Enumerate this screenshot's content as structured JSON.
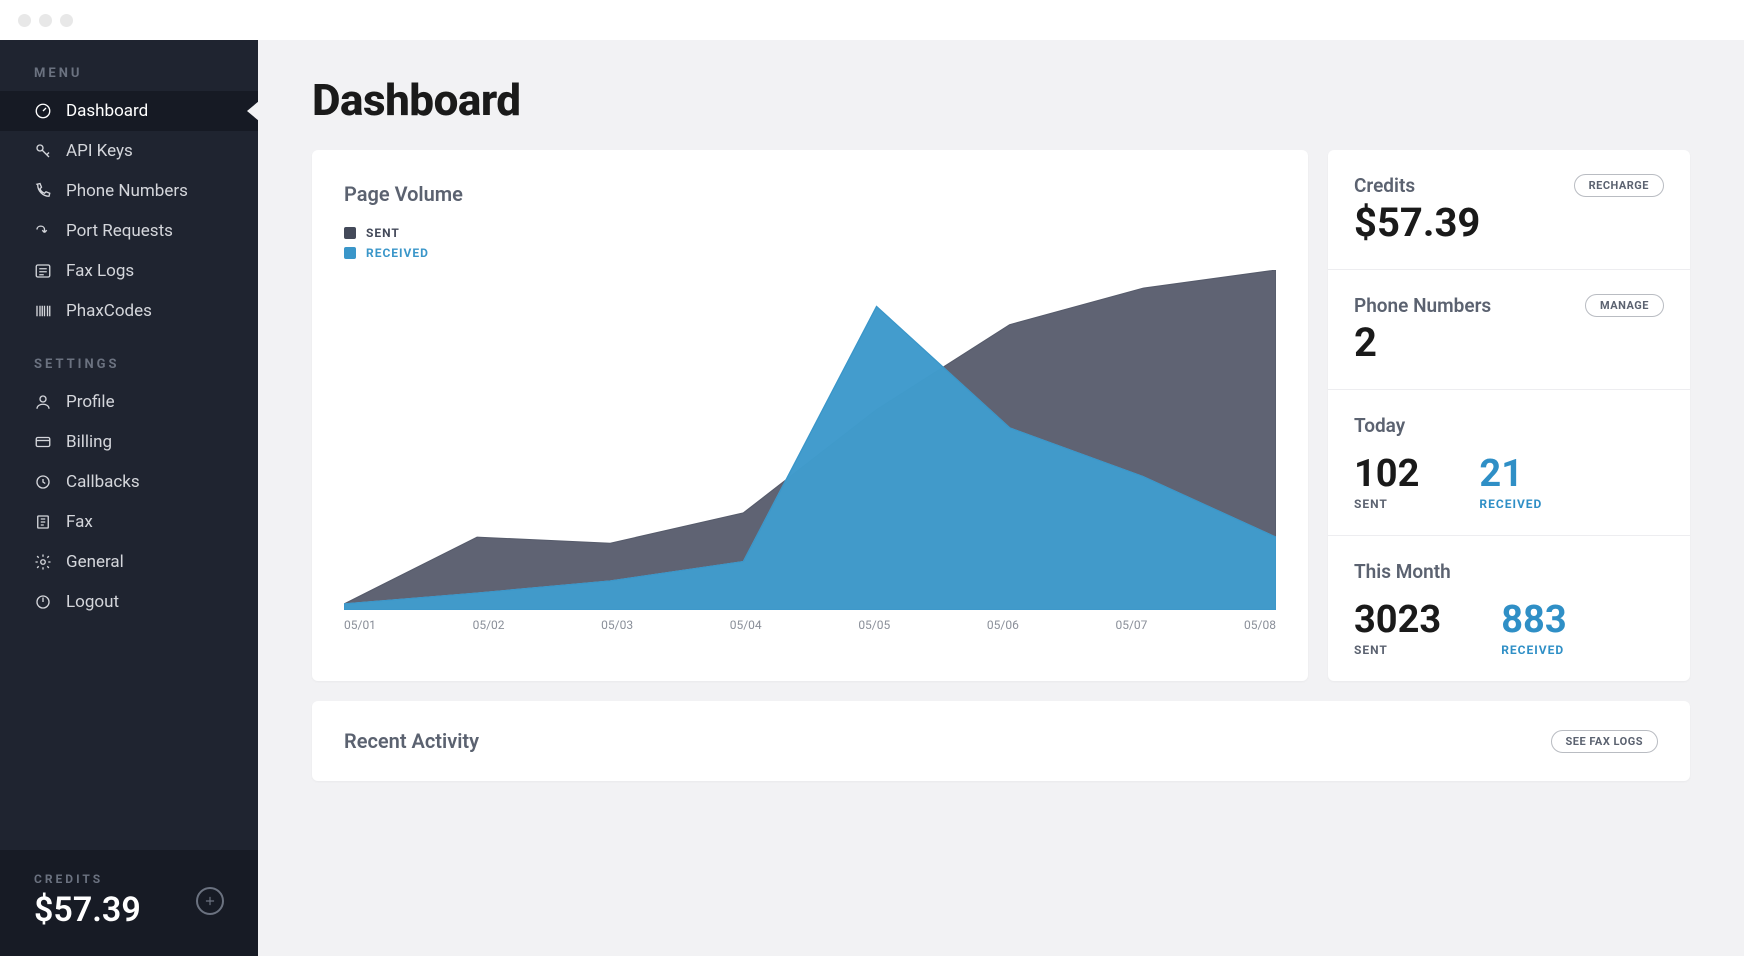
{
  "sidebar": {
    "menu_label": "MENU",
    "settings_label": "SETTINGS",
    "menu_items": [
      {
        "label": "Dashboard",
        "icon": "dashboard",
        "active": true
      },
      {
        "label": "API Keys",
        "icon": "key"
      },
      {
        "label": "Phone Numbers",
        "icon": "phone"
      },
      {
        "label": "Port Requests",
        "icon": "port"
      },
      {
        "label": "Fax Logs",
        "icon": "list"
      },
      {
        "label": "PhaxCodes",
        "icon": "barcode"
      }
    ],
    "settings_items": [
      {
        "label": "Profile",
        "icon": "profile"
      },
      {
        "label": "Billing",
        "icon": "billing"
      },
      {
        "label": "Callbacks",
        "icon": "callback"
      },
      {
        "label": "Fax",
        "icon": "fax"
      },
      {
        "label": "General",
        "icon": "gear"
      },
      {
        "label": "Logout",
        "icon": "logout"
      }
    ],
    "credits_label": "CREDITS",
    "credits_value": "$57.39"
  },
  "page": {
    "title": "Dashboard"
  },
  "chart_card": {
    "title": "Page Volume",
    "legend_sent": "SENT",
    "legend_received": "RECEIVED"
  },
  "chart_data": {
    "type": "area",
    "categories": [
      "05/01",
      "05/02",
      "05/03",
      "05/04",
      "05/05",
      "05/06",
      "05/07",
      "05/08"
    ],
    "series": [
      {
        "name": "SENT",
        "values": [
          5,
          60,
          55,
          80,
          165,
          235,
          265,
          280
        ],
        "color": "#565b6b"
      },
      {
        "name": "RECEIVED",
        "values": [
          5,
          14,
          24,
          40,
          250,
          150,
          110,
          60
        ],
        "color": "#3a96c9"
      }
    ],
    "title": "Page Volume",
    "xlabel": "",
    "ylabel": "",
    "ylim": [
      0,
      280
    ]
  },
  "stats": {
    "credits_label": "Credits",
    "credits_value": "$57.39",
    "recharge_btn": "RECHARGE",
    "phone_label": "Phone Numbers",
    "phone_value": "2",
    "manage_btn": "MANAGE",
    "today_label": "Today",
    "today_sent": "102",
    "today_received": "21",
    "month_label": "This Month",
    "month_sent": "3023",
    "month_received": "883",
    "sent_sub": "SENT",
    "received_sub": "RECEIVED"
  },
  "activity": {
    "title": "Recent Activity",
    "button": "SEE FAX LOGS"
  }
}
